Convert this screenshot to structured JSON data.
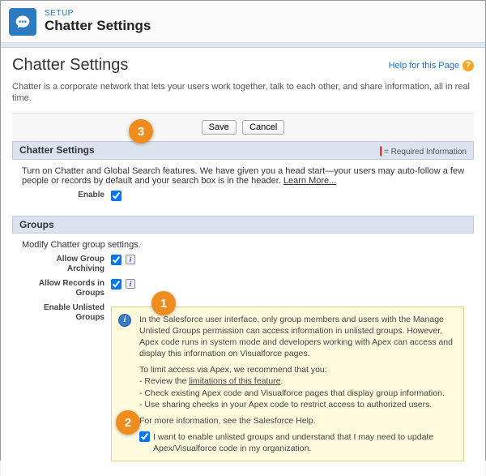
{
  "header": {
    "crumb": "SETUP",
    "title": "Chatter Settings"
  },
  "page": {
    "title": "Chatter Settings",
    "help_link": "Help for this Page",
    "intro": "Chatter is a corporate network that lets your users work together, talk to each other, and share information, all in real time."
  },
  "buttons": {
    "save": "Save",
    "cancel": "Cancel"
  },
  "sections": {
    "chatter": {
      "header": "Chatter Settings",
      "req": "= Required Information",
      "desc": "Turn on Chatter and Global Search features. We have given you a head start—your users may auto-follow a few people or records by default and your search box is in the header. ",
      "learn_more": "Learn More...",
      "enable_label": "Enable"
    },
    "groups": {
      "header": "Groups",
      "desc": "Modify Chatter group settings.",
      "allow_archiving": "Allow Group Archiving",
      "allow_records": "Allow Records in Groups",
      "enable_unlisted": "Enable Unlisted Groups",
      "info_p1": "In the Salesforce user interface, only group members and users with the Manage Unlisted Groups permission can access information in unlisted groups. However, Apex code runs in system mode and developers working with Apex can access and display this information on Visualforce pages.",
      "info_p2": "To limit access via Apex, we recommend that you:",
      "info_b1_pre": "- Review the ",
      "info_b1_link": "limitations of this feature",
      "info_b1_post": ".",
      "info_b2": "- Check existing Apex code and Visualforce pages that display group information.",
      "info_b3": "- Use sharing checks in your Apex code to restrict access to authorized users.",
      "info_p3": "For more information, see the Salesforce Help.",
      "confirm_label": "I want to enable unlisted groups and understand that I may need to update Apex/Visualforce code in my organization."
    }
  },
  "callouts": {
    "c1": "1",
    "c2": "2",
    "c3": "3"
  }
}
